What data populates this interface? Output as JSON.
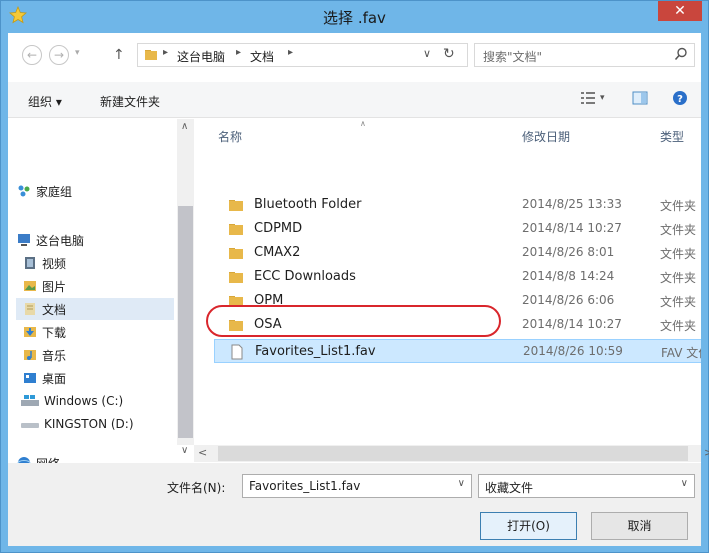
{
  "window": {
    "title": "选择 .fav",
    "close": "✕"
  },
  "address": {
    "crumbs": [
      "这台电脑",
      "文档"
    ]
  },
  "search": {
    "placeholder": "搜索\"文档\""
  },
  "toolbar": {
    "organize": "组织 ▾",
    "new_folder": "新建文件夹"
  },
  "nav": {
    "items": [
      {
        "label": "家庭组",
        "icon": "homegroup-icon"
      },
      {
        "label": "这台电脑",
        "icon": "computer-icon"
      },
      {
        "label": "视频",
        "icon": "videos-icon"
      },
      {
        "label": "图片",
        "icon": "pictures-icon"
      },
      {
        "label": "文档",
        "icon": "documents-icon"
      },
      {
        "label": "下载",
        "icon": "downloads-icon"
      },
      {
        "label": "音乐",
        "icon": "music-icon"
      },
      {
        "label": "桌面",
        "icon": "desktop-icon"
      },
      {
        "label": "Windows (C:)",
        "icon": "drive-icon"
      },
      {
        "label": "KINGSTON (D:)",
        "icon": "usb-drive-icon"
      },
      {
        "label": "网络",
        "icon": "network-icon"
      }
    ]
  },
  "columns": {
    "name": "名称",
    "date": "修改日期",
    "type": "类型"
  },
  "files": [
    {
      "name": "Bluetooth Folder",
      "date": "2014/8/25 13:33",
      "type": "文件夹"
    },
    {
      "name": "CDPMD",
      "date": "2014/8/14 10:27",
      "type": "文件夹"
    },
    {
      "name": "CMAX2",
      "date": "2014/8/26 8:01",
      "type": "文件夹"
    },
    {
      "name": "ECC Downloads",
      "date": "2014/8/8 14:24",
      "type": "文件夹"
    },
    {
      "name": "OPM",
      "date": "2014/8/26 6:06",
      "type": "文件夹"
    },
    {
      "name": "OSA",
      "date": "2014/8/14 10:27",
      "type": "文件夹"
    },
    {
      "name": "Favorites_List1.fav",
      "date": "2014/8/26 10:59",
      "type": "FAV 文件"
    }
  ],
  "bottom": {
    "filename_label": "文件名(N):",
    "filename_value": "Favorites_List1.fav",
    "filter_value": "收藏文件",
    "open_label": "打开(O)",
    "cancel_label": "取消"
  },
  "colors": {
    "titlebar": "#6fb6e8",
    "close": "#c9463d",
    "folder": "#e8b84a",
    "selection": "#cce8ff",
    "highlight": "#d9262c"
  }
}
